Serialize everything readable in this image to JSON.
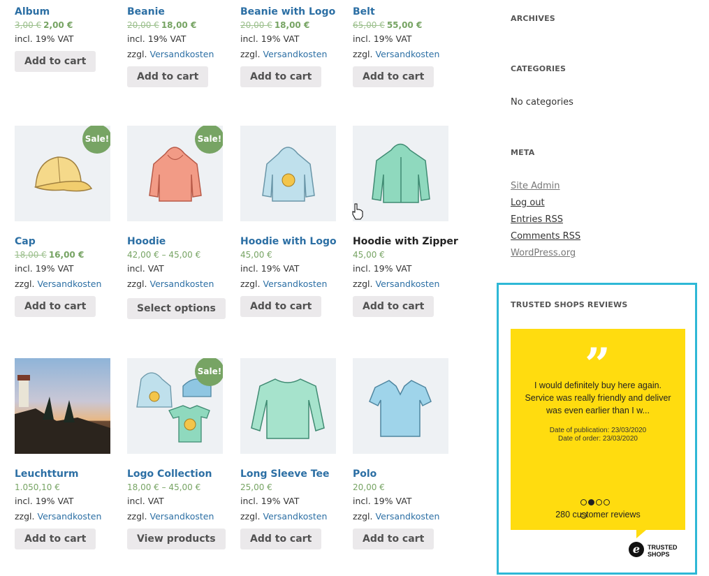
{
  "products": [
    {
      "title": "Album",
      "old": "3,00 €",
      "price": "2,00 €",
      "vat": "incl. 19% VAT",
      "shipping_prefix": "",
      "shipping_link": "",
      "button": "Add to cart"
    },
    {
      "title": "Beanie",
      "old": "20,00 €",
      "price": "18,00 €",
      "vat": "incl. 19% VAT",
      "shipping_prefix": "zzgl.",
      "shipping_link": "Versandkosten",
      "button": "Add to cart"
    },
    {
      "title": "Beanie with Logo",
      "old": "20,00 €",
      "price": "18,00 €",
      "vat": "incl. 19% VAT",
      "shipping_prefix": "zzgl.",
      "shipping_link": "Versandkosten",
      "button": "Add to cart"
    },
    {
      "title": "Belt",
      "old": "65,00 €",
      "price": "55,00 €",
      "vat": "incl. 19% VAT",
      "shipping_prefix": "zzgl.",
      "shipping_link": "Versandkosten",
      "button": "Add to cart"
    },
    {
      "title": "Cap",
      "old": "18,00 €",
      "price": "16,00 €",
      "vat": "incl. 19% VAT",
      "shipping_prefix": "zzgl.",
      "shipping_link": "Versandkosten",
      "button": "Add to cart",
      "sale": "Sale!"
    },
    {
      "title": "Hoodie",
      "old": "",
      "price": "42,00 € – 45,00 €",
      "vat": "incl. VAT",
      "shipping_prefix": "zzgl.",
      "shipping_link": "Versandkosten",
      "button": "Select options",
      "sale": "Sale!"
    },
    {
      "title": "Hoodie with Logo",
      "old": "",
      "price": "45,00 €",
      "vat": "incl. 19% VAT",
      "shipping_prefix": "zzgl.",
      "shipping_link": "Versandkosten",
      "button": "Add to cart"
    },
    {
      "title": "Hoodie with Zipper",
      "old": "",
      "price": "45,00 €",
      "vat": "incl. 19% VAT",
      "shipping_prefix": "zzgl.",
      "shipping_link": "Versandkosten",
      "button": "Add to cart"
    },
    {
      "title": "Leuchtturm",
      "old": "",
      "price": "1.050,10 €",
      "vat": "incl. 19% VAT",
      "shipping_prefix": "zzgl.",
      "shipping_link": "Versandkosten",
      "button": "Add to cart"
    },
    {
      "title": "Logo Collection",
      "old": "",
      "price": "18,00 € – 45,00 €",
      "vat": "incl. VAT",
      "shipping_prefix": "zzgl.",
      "shipping_link": "Versandkosten",
      "button": "View products",
      "sale": "Sale!"
    },
    {
      "title": "Long Sleeve Tee",
      "old": "",
      "price": "25,00 €",
      "vat": "incl. 19% VAT",
      "shipping_prefix": "zzgl.",
      "shipping_link": "Versandkosten",
      "button": "Add to cart"
    },
    {
      "title": "Polo",
      "old": "",
      "price": "20,00 €",
      "vat": "incl. 19% VAT",
      "shipping_prefix": "zzgl.",
      "shipping_link": "Versandkosten",
      "button": "Add to cart"
    }
  ],
  "sidebar": {
    "archives_title": "ARCHIVES",
    "categories_title": "CATEGORIES",
    "categories_empty": "No categories",
    "meta_title": "META",
    "meta_links": [
      "Site Admin",
      "Log out",
      "Entries RSS",
      "Comments RSS",
      "WordPress.org"
    ]
  },
  "trusted_shops": {
    "title": "TRUSTED SHOPS REVIEWS",
    "quote_mark": "”",
    "review": "I would definitely buy here again. Service was really friendly and deliver was even earlier than I w...",
    "date_publication": "Date of publication: 23/03/2020",
    "date_order": "Date of order: 23/03/2020",
    "count": "280 customer reviews",
    "logo_mark": "e",
    "logo_line1": "TRUSTED",
    "logo_line2": "SHOPS"
  },
  "colors": {
    "link": "#2c6fa4",
    "sale": "#77a464",
    "badge_border": "#2eb8d6",
    "review_bg": "#ffdc0f"
  }
}
